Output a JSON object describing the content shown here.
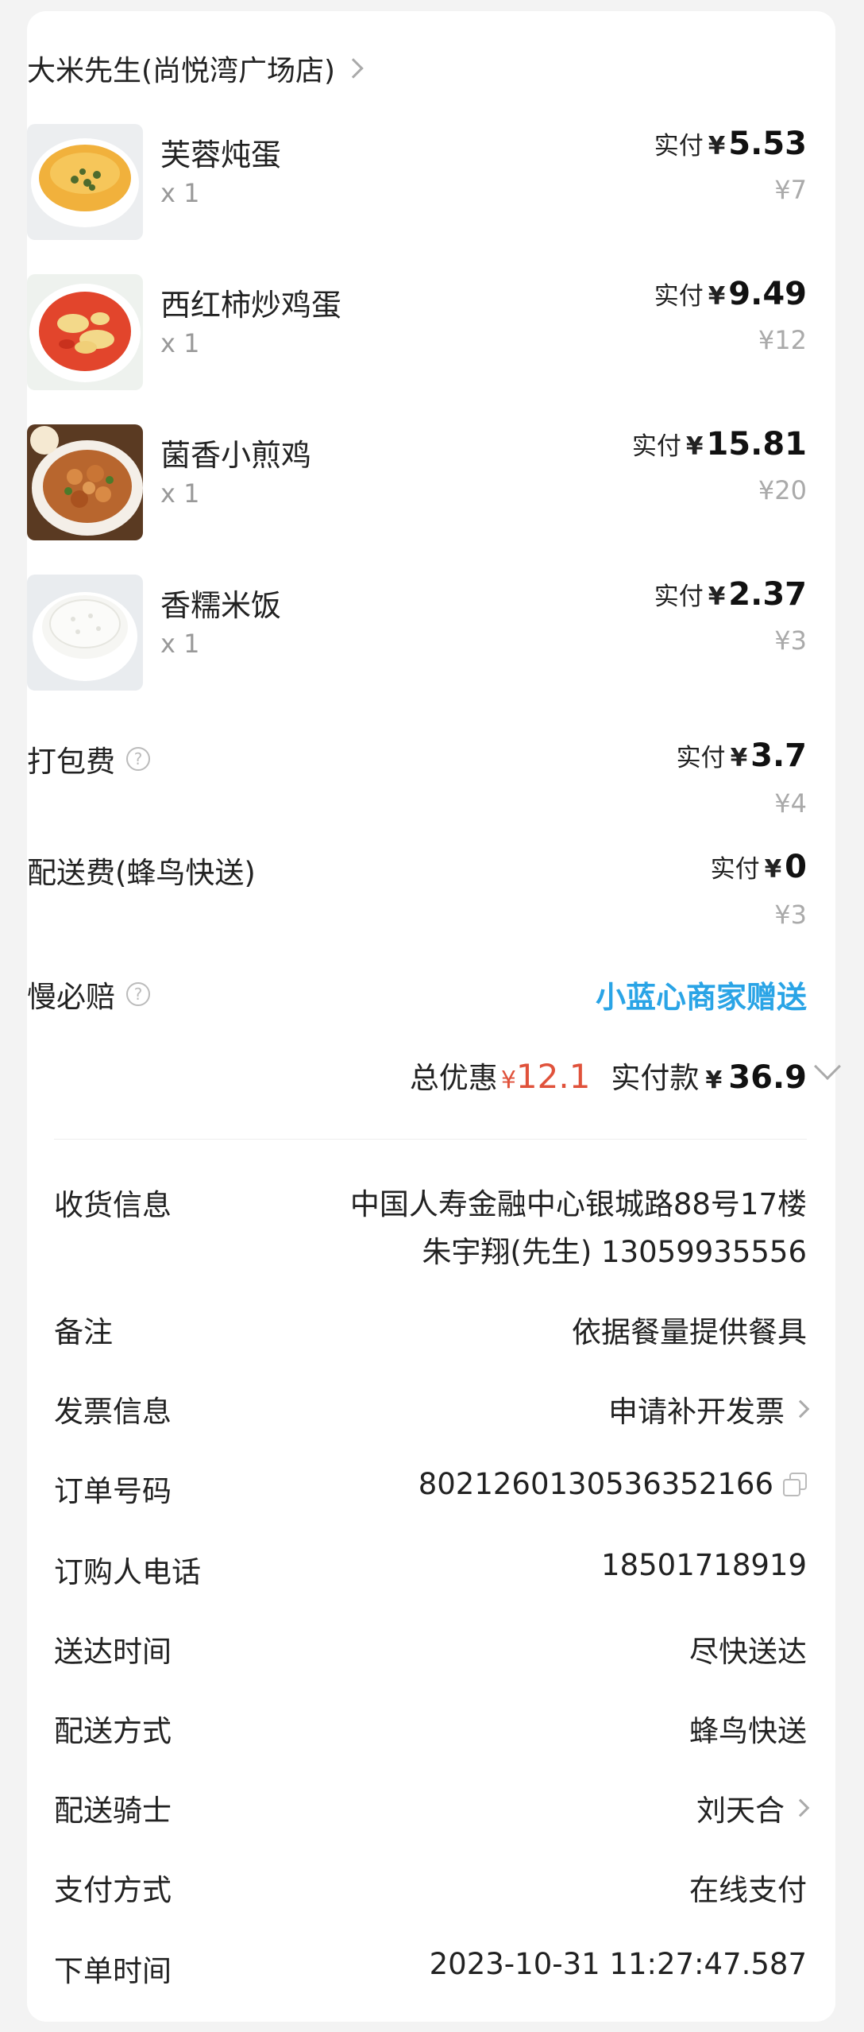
{
  "shop": {
    "name": "大米先生(尚悦湾广场店)"
  },
  "items": [
    {
      "name": "芙蓉炖蛋",
      "qty": "x 1",
      "paid_label": "实付",
      "currency": "¥",
      "paid": "5.53",
      "original": "¥7",
      "image": "steamed-egg-image"
    },
    {
      "name": "西红柿炒鸡蛋",
      "qty": "x 1",
      "paid_label": "实付",
      "currency": "¥",
      "paid": "9.49",
      "original": "¥12",
      "image": "tomato-egg-image"
    },
    {
      "name": "菌香小煎鸡",
      "qty": "x 1",
      "paid_label": "实付",
      "currency": "¥",
      "paid": "15.81",
      "original": "¥20",
      "image": "fried-chicken-image"
    },
    {
      "name": "香糯米饭",
      "qty": "x 1",
      "paid_label": "实付",
      "currency": "¥",
      "paid": "2.37",
      "original": "¥3",
      "image": "rice-image"
    }
  ],
  "fees": {
    "packing": {
      "name": "打包费",
      "paid_label": "实付",
      "currency": "¥",
      "paid": "3.7",
      "original": "¥4"
    },
    "delivery": {
      "name": "配送费(蜂鸟快送)",
      "paid_label": "实付",
      "currency": "¥",
      "paid": "0",
      "original": "¥3"
    },
    "late": {
      "name": "慢必赔",
      "promo": "小蓝心商家赠送"
    }
  },
  "summary": {
    "discount_label": "总优惠",
    "discount_currency": "¥",
    "discount_value": "12.1",
    "total_label": "实付款",
    "total_currency": "¥",
    "total_value": "36.9"
  },
  "info": {
    "address_label": "收货信息",
    "address_line1": "中国人寿金融中心银城路88号17楼",
    "address_line2": "朱宇翔(先生) 13059935556",
    "remark_label": "备注",
    "remark_value": "依据餐量提供餐具",
    "invoice_label": "发票信息",
    "invoice_value": "申请补开发票",
    "order_label": "订单号码",
    "order_value": "8021260130536352166",
    "phone_label": "订购人电话",
    "phone_value": "18501718919",
    "time_label": "送达时间",
    "time_value": "尽快送达",
    "method_label": "配送方式",
    "method_value": "蜂鸟快送",
    "rider_label": "配送骑士",
    "rider_value": "刘天合",
    "pay_label": "支付方式",
    "pay_value": "在线支付",
    "created_label": "下单时间",
    "created_value": "2023-10-31 11:27:47.587"
  },
  "colors": {
    "accent_blue": "#2aa4e6",
    "discount_red": "#e0523b"
  }
}
